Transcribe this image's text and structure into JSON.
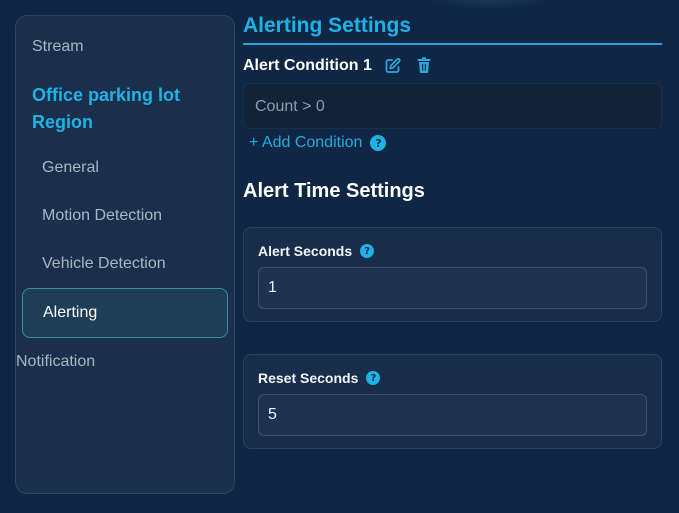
{
  "sidebar": {
    "stream": "Stream",
    "region": "Office parking lot Region",
    "general": "General",
    "motion_detection": "Motion Detection",
    "vehicle_detection": "Vehicle Detection",
    "alerting": "Alerting",
    "notification": "Notification",
    "active_item": "Alerting"
  },
  "alerting": {
    "title": "Alerting Settings",
    "condition_label": "Alert Condition 1",
    "condition_expression": "Count > 0",
    "add_condition": "+ Add Condition",
    "help_glyph": "?"
  },
  "time_settings": {
    "title": "Alert Time Settings",
    "alert_seconds_label": "Alert Seconds",
    "alert_seconds_value": "1",
    "reset_seconds_label": "Reset Seconds",
    "reset_seconds_value": "5"
  },
  "icons": {
    "edit": "edit-icon",
    "delete": "trash-icon",
    "help": "help-icon"
  },
  "colors": {
    "background": "#0f2744",
    "accent": "#1eb3e6",
    "panel": "#1a2f4b"
  }
}
